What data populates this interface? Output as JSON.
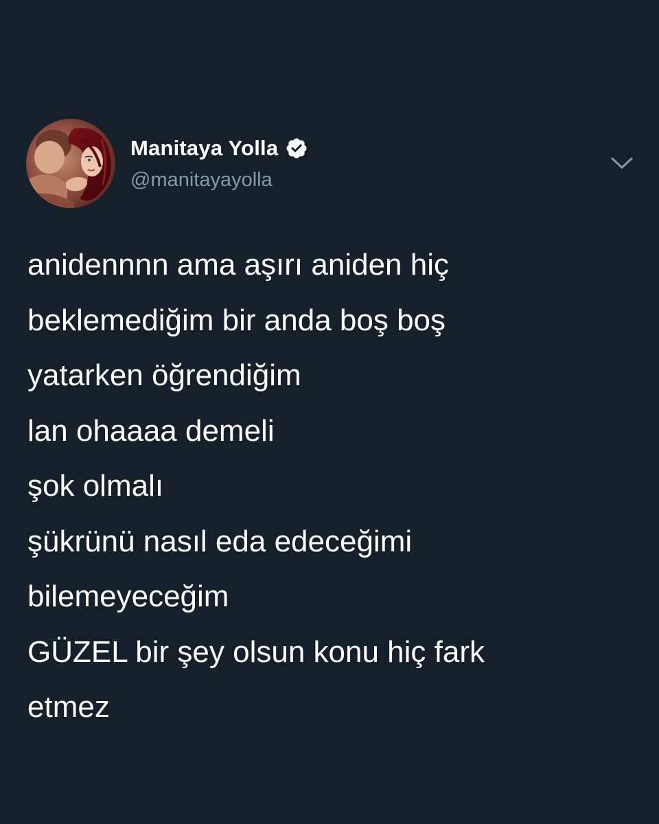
{
  "tweet": {
    "author": {
      "display_name": "Manitaya Yolla",
      "handle": "@manitayayolla",
      "verified": true,
      "avatar_icon": "illustrated-couple-avatar",
      "verified_icon": "verified-badge-icon"
    },
    "menu_icon": "chevron-down-icon",
    "text_lines": [
      "anidennnn ama aşırı aniden hiç",
      "beklemediğim bir anda boş boş",
      "yatarken öğrendiğim",
      "lan ohaaaa demeli",
      "şok olmalı",
      "şükrünü nasıl eda edeceğimi",
      "bilemeyeceğim",
      "GÜZEL bir şey olsun konu hiç fark",
      "etmez"
    ]
  },
  "colors": {
    "background": "#15202b",
    "text_primary": "#ffffff",
    "text_secondary": "#8899a6",
    "chevron": "#8899a6"
  }
}
